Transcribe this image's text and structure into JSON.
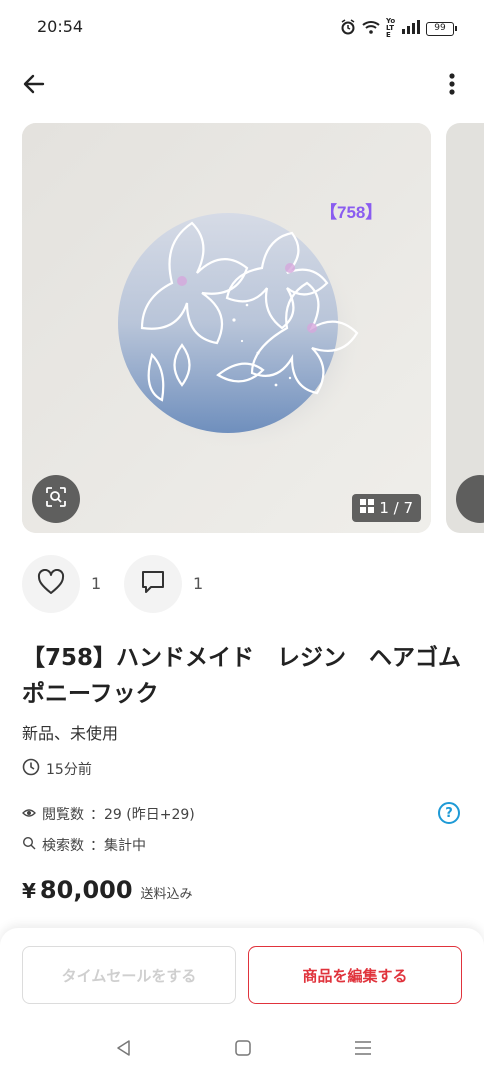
{
  "status_bar": {
    "time": "20:54",
    "network": "Yo LTE",
    "battery": "99"
  },
  "gallery": {
    "watermark": "【758】",
    "counter": "1 / 7",
    "current_image": 1,
    "total_images": 7
  },
  "actions": {
    "like_count": "1",
    "comment_count": "1"
  },
  "item": {
    "title": "【758】ハンドメイド　レジン　ヘアゴム　ポニーフック",
    "condition": "新品、未使用",
    "posted": "15分前",
    "views_label": "閲覧数",
    "views_value": "：29 (昨日+29)",
    "search_label": "検索数",
    "search_value": "：集計中",
    "price_symbol": "¥",
    "price": "80,000",
    "shipping": "送料込み"
  },
  "buttons": {
    "time_sale": "タイムセールをする",
    "edit_item": "商品を編集する"
  },
  "colors": {
    "accent_red": "#e0333c",
    "help_blue": "#1e9ad6",
    "watermark_purple": "#8a5cf0"
  }
}
